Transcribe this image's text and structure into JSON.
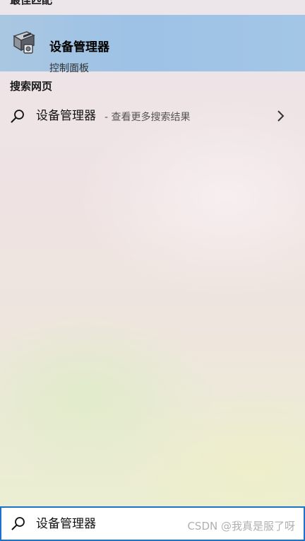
{
  "best_match": {
    "header": "最佳匹配",
    "title": "设备管理器",
    "subtitle": "控制面板",
    "icon": "device-manager-icon"
  },
  "web_search": {
    "header": "搜索网页",
    "query": "设备管理器",
    "hint": "- 查看更多搜索结果",
    "icon": "search-icon",
    "arrow_icon": "chevron-right-icon"
  },
  "search_box": {
    "value": "设备管理器",
    "icon": "search-icon"
  },
  "watermark": "CSDN @我真是服了呀",
  "colors": {
    "selection": "#9dc2e6",
    "search_border": "#1a73c9"
  }
}
